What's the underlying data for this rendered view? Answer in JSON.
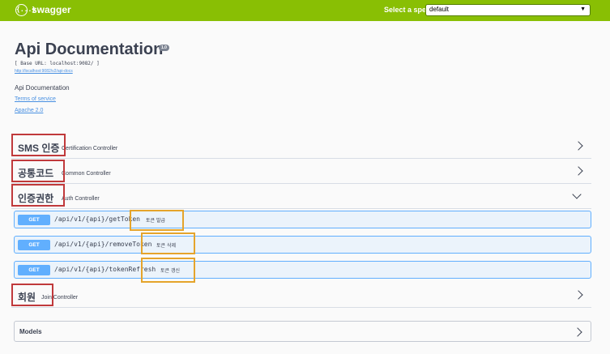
{
  "topbar": {
    "logo_text": "swagger",
    "logo_glyph": "{...}",
    "spec_label": "Select a spec",
    "spec_selected": "default"
  },
  "info": {
    "title": "Api Documentation",
    "version": "1.0",
    "base_url": "[ Base URL: localhost:9082/ ]",
    "api_docs_url": "http://localhost:9082/v2/api-docs",
    "description": "Api Documentation",
    "terms_of_service": "Terms of service",
    "license": "Apache 2.0"
  },
  "tags": [
    {
      "name": "SMS 인증",
      "description": "Certification Controller",
      "expanded": false
    },
    {
      "name": "공통코드",
      "description": "Common Controller",
      "expanded": false
    },
    {
      "name": "인증권한",
      "description": "Auth Controller",
      "expanded": true
    },
    {
      "name": "회원",
      "description": "Join Controller",
      "expanded": false
    }
  ],
  "operations": [
    {
      "method": "GET",
      "path": "/api/v1/{api}/getToken",
      "summary": "토큰 발급"
    },
    {
      "method": "GET",
      "path": "/api/v1/{api}/removeToken",
      "summary": "토큰 삭제"
    },
    {
      "method": "GET",
      "path": "/api/v1/{api}/tokenRefresh",
      "summary": "토큰 갱신"
    }
  ],
  "models": {
    "label": "Models"
  },
  "colors": {
    "topbar": "#89bf04",
    "get_method": "#61affe",
    "get_bg": "#ebf3fb",
    "annotation_red": "#c0393b",
    "annotation_orange": "#e5a42b"
  }
}
